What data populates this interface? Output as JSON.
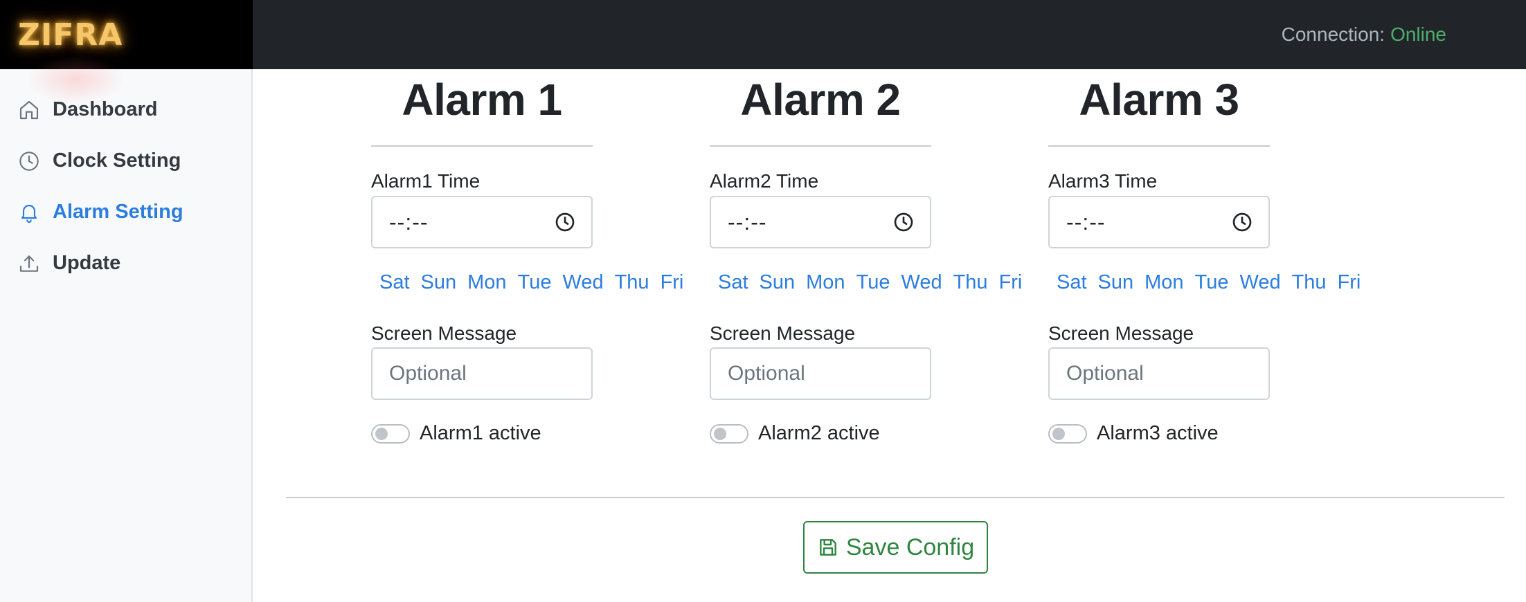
{
  "header": {
    "brand": "ZIFRA",
    "connection_label": "Connection:",
    "connection_status": "Online",
    "status_color": "#4caf6a"
  },
  "sidebar": {
    "items": [
      {
        "label": "Dashboard",
        "icon": "home-icon",
        "active": false
      },
      {
        "label": "Clock Setting",
        "icon": "clock-icon",
        "active": false
      },
      {
        "label": "Alarm Setting",
        "icon": "bell-icon",
        "active": true
      },
      {
        "label": "Update",
        "icon": "upload-icon",
        "active": false
      }
    ]
  },
  "alarms": [
    {
      "title": "Alarm 1",
      "time_label": "Alarm1 Time",
      "time_value": "--:--",
      "days": [
        "Sat",
        "Sun",
        "Mon",
        "Tue",
        "Wed",
        "Thu",
        "Fri"
      ],
      "message_label": "Screen Message",
      "message_placeholder": "Optional",
      "active_label": "Alarm1 active",
      "active": false
    },
    {
      "title": "Alarm 2",
      "time_label": "Alarm2 Time",
      "time_value": "--:--",
      "days": [
        "Sat",
        "Sun",
        "Mon",
        "Tue",
        "Wed",
        "Thu",
        "Fri"
      ],
      "message_label": "Screen Message",
      "message_placeholder": "Optional",
      "active_label": "Alarm2 active",
      "active": false
    },
    {
      "title": "Alarm 3",
      "time_label": "Alarm3 Time",
      "time_value": "--:--",
      "days": [
        "Sat",
        "Sun",
        "Mon",
        "Tue",
        "Wed",
        "Thu",
        "Fri"
      ],
      "message_label": "Screen Message",
      "message_placeholder": "Optional",
      "active_label": "Alarm3 active",
      "active": false
    }
  ],
  "save_button": {
    "label": "Save Config",
    "icon": "save-icon",
    "color": "#2e8540"
  },
  "accent_color": "#2b7de0"
}
